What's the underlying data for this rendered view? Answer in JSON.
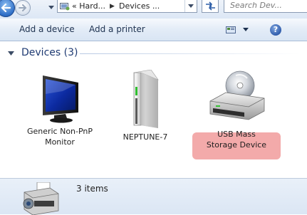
{
  "address": {
    "crumbs": [
      "« Hard...",
      "Devices ..."
    ],
    "search_placeholder": "Search Dev..."
  },
  "commands": {
    "add_device": "Add a device",
    "add_printer": "Add a printer",
    "help": "?"
  },
  "group": {
    "title": "Devices (3)"
  },
  "devices": [
    {
      "line1": "Generic Non-PnP",
      "line2": "Monitor",
      "icon": "monitor-icon",
      "selected": false
    },
    {
      "line1": "NEPTUNE-7",
      "line2": "",
      "icon": "pc-tower-icon",
      "selected": false
    },
    {
      "line1": "USB Mass",
      "line2": "Storage Device",
      "icon": "usb-storage-disc-icon",
      "selected": true
    }
  ],
  "details": {
    "count": "3 items"
  },
  "colors": {
    "selection": "#f3aaaa",
    "group_header": "#1e3a72"
  }
}
